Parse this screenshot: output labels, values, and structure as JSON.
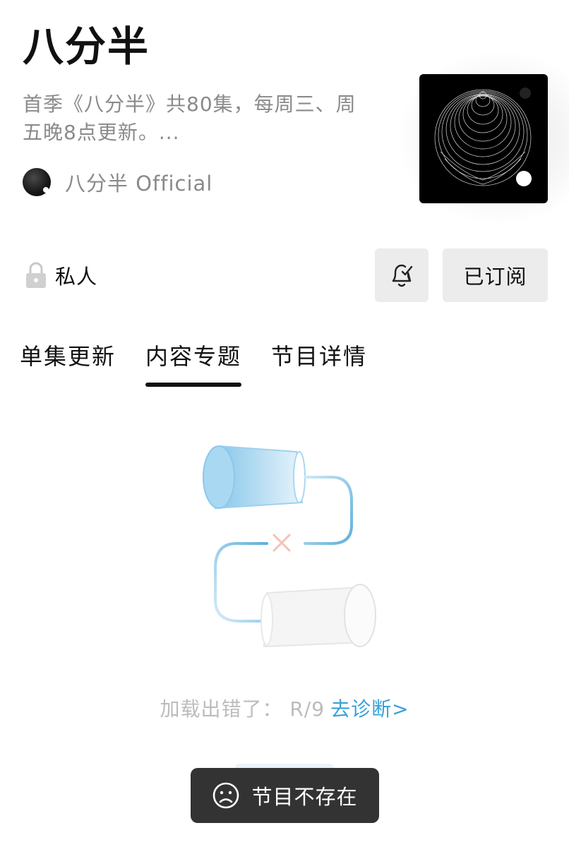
{
  "podcast": {
    "title": "八分半",
    "description": "首季《八分半》共80集，每周三、周五晚8点更新。...",
    "author": "八分半 Official"
  },
  "privacy": {
    "label": "私人",
    "icon": "lock-icon"
  },
  "actions": {
    "subscribe_label": "已订阅",
    "notify_icon": "bell-check-icon"
  },
  "tabs": [
    {
      "label": "单集更新",
      "active": false
    },
    {
      "label": "内容专题",
      "active": true
    },
    {
      "label": "节目详情",
      "active": false
    }
  ],
  "error": {
    "message": "加载出错了： R/9",
    "link": "去诊断>"
  },
  "toast": {
    "message": "节目不存在",
    "icon": "sad-face-icon"
  },
  "colors": {
    "link": "#3aa0d8",
    "toast_bg": "#333333",
    "button_bg": "#ececec"
  }
}
